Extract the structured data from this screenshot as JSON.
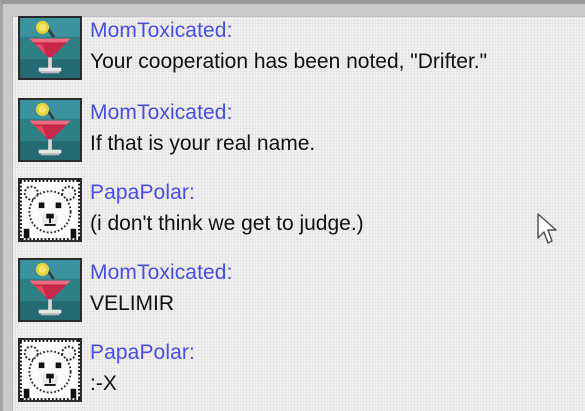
{
  "colors": {
    "sender_name": "#4a4fe0",
    "message_text": "#111111",
    "panel_background": "#f0f0f0"
  },
  "chat": {
    "messages": [
      {
        "sender": "MomToxicated:",
        "text": "Your cooperation has been noted, \"Drifter.\"",
        "avatar": "cocktail-icon"
      },
      {
        "sender": "MomToxicated:",
        "text": "If that is your real name.",
        "avatar": "cocktail-icon"
      },
      {
        "sender": "PapaPolar:",
        "text": "(i don't think we get to judge.)",
        "avatar": "polar-bear-icon"
      },
      {
        "sender": "MomToxicated:",
        "text": "VELIMIR",
        "avatar": "cocktail-icon"
      },
      {
        "sender": "PapaPolar:",
        "text": ":-X",
        "avatar": "polar-bear-icon"
      }
    ]
  },
  "cursor": {
    "icon": "mouse-pointer-icon"
  }
}
